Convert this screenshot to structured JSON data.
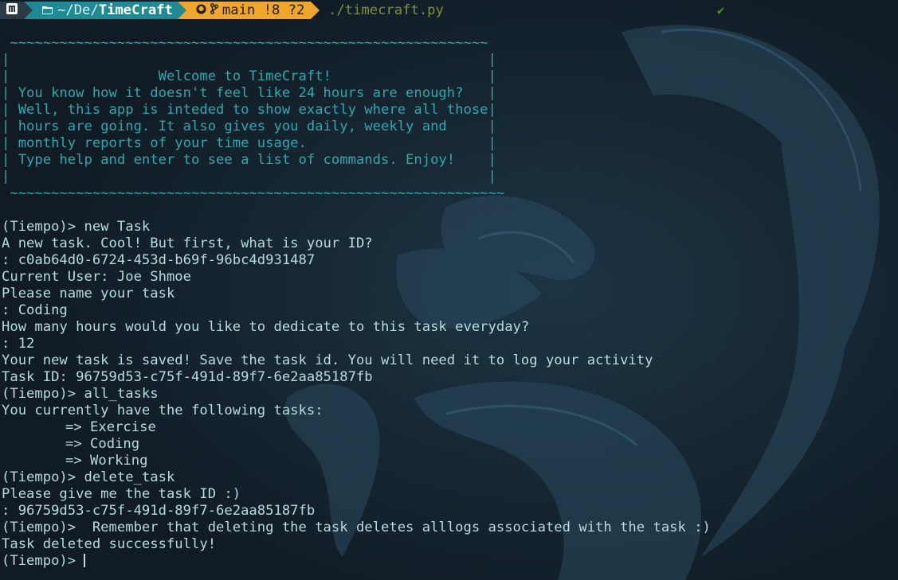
{
  "prompt": {
    "os_icon": "fedora-logo-icon",
    "dir_icon": "folder-icon",
    "dir_prefix": "~/De/",
    "dir_name": "TimeCraft",
    "git_icon": "github-octocat-icon",
    "branch_icon": "git-branch-icon",
    "git_status": "main !8 ?2",
    "command": "./timecraft.py",
    "status_mark": "✔"
  },
  "banner": {
    "top_border": " ~~~~~~~~~~~~~~~~~~~~~~~~~~~~~~~~~~~~~~~~~~~~~~~~~~~~~~~~~~",
    "lines": [
      "|                                                          |",
      "|                  Welcome to TimeCraft!                   |",
      "| You know how it doesn't feel like 24 hours are enough?   |",
      "| Well, this app is inteded to show exactly where all those|",
      "| hours are going. It also gives you daily, weekly and     |",
      "| monthly reports of your time usage.                      |",
      "| Type help and enter to see a list of commands. Enjoy!    |",
      "|                                                          |"
    ],
    "bottom_border": " ~~~~~~~~~~~~~~~~~~~~~~~~~~~~~~~~~~~~~~~~~~~~~~~~~~~~~~~~~~~~"
  },
  "session": {
    "l01": "(Tiempo)> new Task",
    "l02": "A new task. Cool! But first, what is your ID?",
    "l03": ": c0ab64d0-6724-453d-b69f-96bc4d931487",
    "l04": "Current User: Joe Shmoe",
    "l05": "Please name your task",
    "l06": ": Coding",
    "l07": "How many hours would you like to dedicate to this task everyday?",
    "l08": ": 12",
    "l09": "Your new task is saved! Save the task id. You will need it to log your activity",
    "l10": "Task ID: 96759d53-c75f-491d-89f7-6e2aa85187fb",
    "l11": "(Tiempo)> all_tasks",
    "l12": "You currently have the following tasks:",
    "tasks": [
      "=> Exercise",
      "=> Coding",
      "=> Working"
    ],
    "l16": "(Tiempo)> delete_task",
    "l17": "Please give me the task ID :)",
    "l18": ": 96759d53-c75f-491d-89f7-6e2aa85187fb",
    "l19": "(Tiempo)>  Remember that deleting the task deletes alllogs associated with the task :)",
    "l20": "Task deleted successfully!",
    "l21": "(Tiempo)> "
  },
  "colors": {
    "background": "#13202b",
    "text": "#b7dcdc",
    "banner": "#2fa8ad",
    "seg_os": "#2b3a44",
    "seg_dir": "#1f8a93",
    "seg_git": "#f0a52b"
  }
}
